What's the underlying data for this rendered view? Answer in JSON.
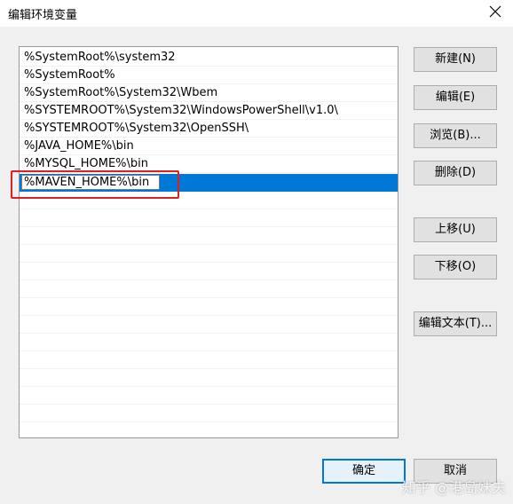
{
  "window": {
    "title": "编辑环境变量",
    "close_icon": "close-icon"
  },
  "paths": [
    "%SystemRoot%\\system32",
    "%SystemRoot%",
    "%SystemRoot%\\System32\\Wbem",
    "%SYSTEMROOT%\\System32\\WindowsPowerShell\\v1.0\\",
    "%SYSTEMROOT%\\System32\\OpenSSH\\",
    "%JAVA_HOME%\\bin",
    "%MYSQL_HOME%\\bin",
    "%MAVEN_HOME%\\bin"
  ],
  "selected_index": 7,
  "buttons": {
    "new": "新建(N)",
    "edit": "编辑(E)",
    "browse": "浏览(B)...",
    "delete": "删除(D)",
    "move_up": "上移(U)",
    "move_down": "下移(O)",
    "edit_text": "编辑文本(T)...",
    "ok": "确定",
    "cancel": "取消"
  },
  "watermark": "知乎 @港岛妹夫",
  "colors": {
    "selection": "#0078d7",
    "annotation": "#e02020",
    "dialog_bg": "#f0f0f0"
  }
}
